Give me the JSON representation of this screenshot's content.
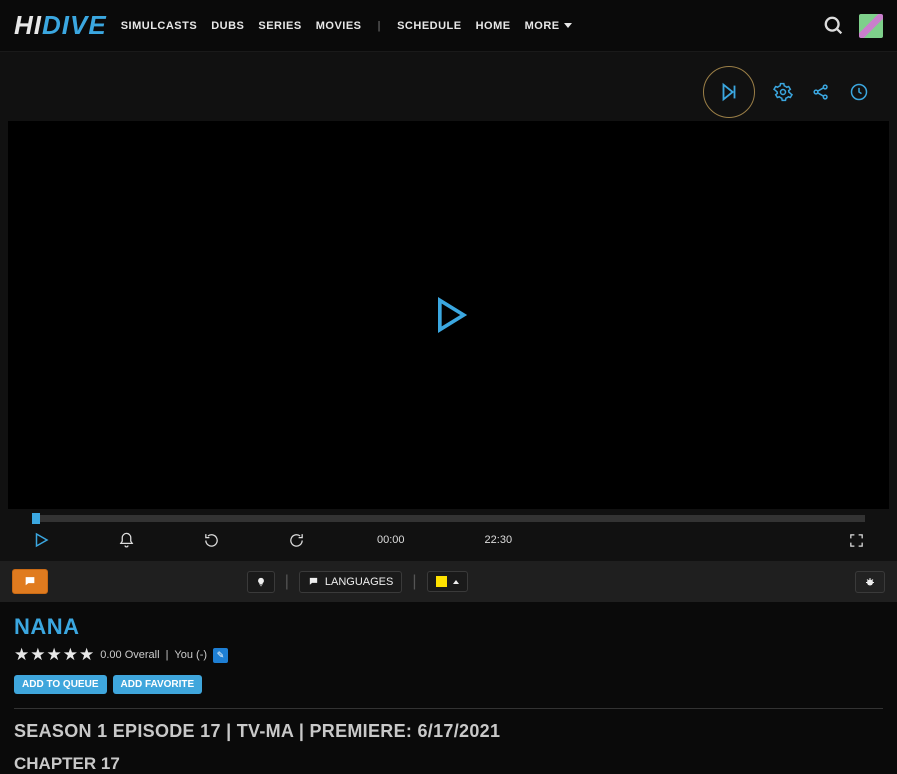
{
  "logo": {
    "part1": "HI",
    "part2": "DIVE"
  },
  "nav": {
    "simulcasts": "SIMULCASTS",
    "dubs": "DUBS",
    "series": "SERIES",
    "movies": "MOVIES",
    "schedule": "SCHEDULE",
    "home": "HOME",
    "more": "MORE"
  },
  "player": {
    "current_time": "00:00",
    "total_time": "22:30"
  },
  "infobar": {
    "languages_label": "LANGUAGES"
  },
  "show": {
    "title": "NANA",
    "rating_overall": "0.00 Overall",
    "rating_you": "You (-)",
    "add_to_queue": "ADD TO QUEUE",
    "add_favorite": "ADD FAVORITE"
  },
  "episode": {
    "meta": "SEASON 1 EPISODE 17 | TV-MA | PREMIERE: 6/17/2021",
    "chapter": "CHAPTER 17"
  }
}
